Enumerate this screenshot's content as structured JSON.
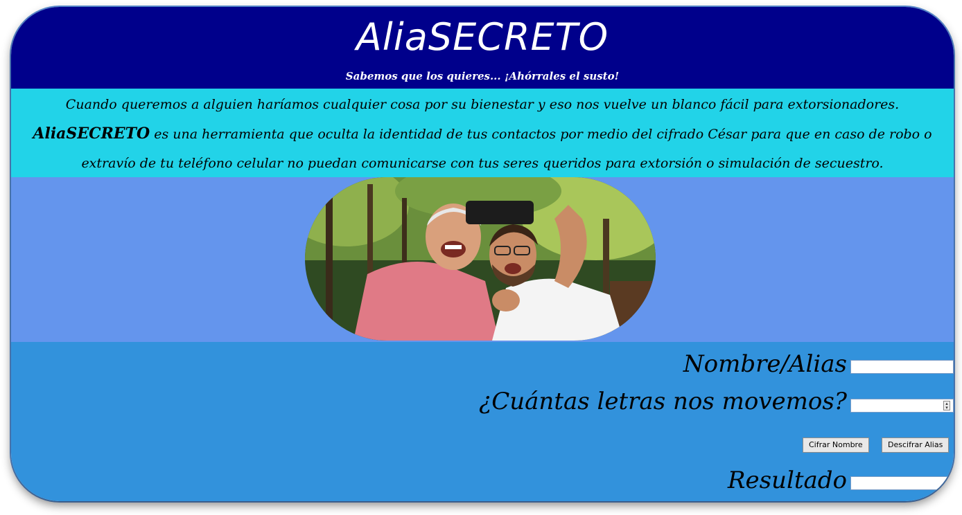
{
  "header": {
    "title": "AliaSECRETO",
    "subtitle": "Sabemos que los quieres... ¡Ahórrales el susto!"
  },
  "intro": {
    "line1": "Cuando queremos a alguien haríamos cualquier cosa por su bienestar y eso nos vuelve un blanco fácil para extorsionadores.",
    "line2_brand": "AliaSECRETO",
    "line2_rest": " es una herramienta que oculta la identidad de tus contactos por medio del cifrado César para que en caso de robo o",
    "line3": "extravío de tu teléfono celular no puedan comunicarse con tus seres queridos para extorsión o simulación de secuestro."
  },
  "photo": {
    "icon": "family-selfie-photo"
  },
  "form": {
    "name_label": "Nombre/Alias",
    "name_value": "",
    "shift_label": "¿Cuántas letras nos movemos?",
    "shift_value": "",
    "encrypt_button": "Cifrar Nombre",
    "decrypt_button": "Descifrar Alias",
    "result_label": "Resultado",
    "result_value": ""
  },
  "colors": {
    "header_bg": "#00008b",
    "intro_bg": "#22d3e8",
    "photo_band_bg": "#6495ed",
    "form_bg": "#3292dc"
  }
}
